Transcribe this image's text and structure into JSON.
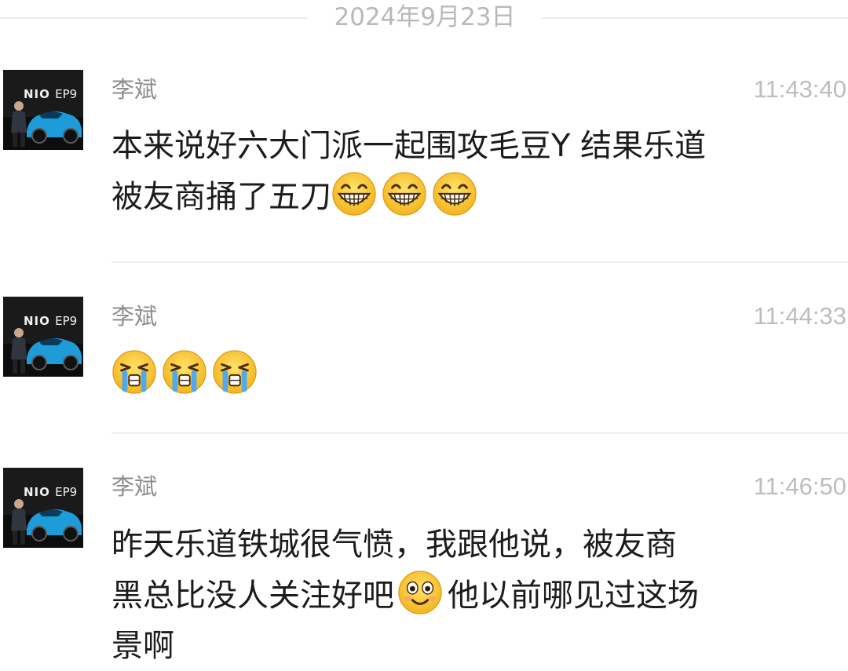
{
  "date_divider": "2024年9月23日",
  "messages": [
    {
      "sender": "李斌",
      "time": "11:43:40",
      "line1": "本来说好六大门派一起围攻毛豆Y 结果乐道",
      "line2": "被友商捅了五刀",
      "emojis": [
        "grin-icon",
        "grin-icon",
        "grin-icon"
      ]
    },
    {
      "sender": "李斌",
      "time": "11:44:33",
      "emojis": [
        "crying-icon",
        "crying-icon",
        "crying-icon"
      ]
    },
    {
      "sender": "李斌",
      "time": "11:46:50",
      "line1": "昨天乐道铁城很气愤，我跟他说，被友商",
      "line2a": "黑总比没人关注好吧",
      "line2b": "他以前哪见过这场",
      "line3": "景啊",
      "emojis": [
        "smile-icon"
      ]
    }
  ],
  "avatar": {
    "brand": "NIO",
    "brand_suffix": "EP9"
  },
  "colors": {
    "timestamp": "#bdbdbd",
    "sender": "#8d8d8d",
    "text": "#1c1c1c",
    "car": "#1e9bd9"
  }
}
